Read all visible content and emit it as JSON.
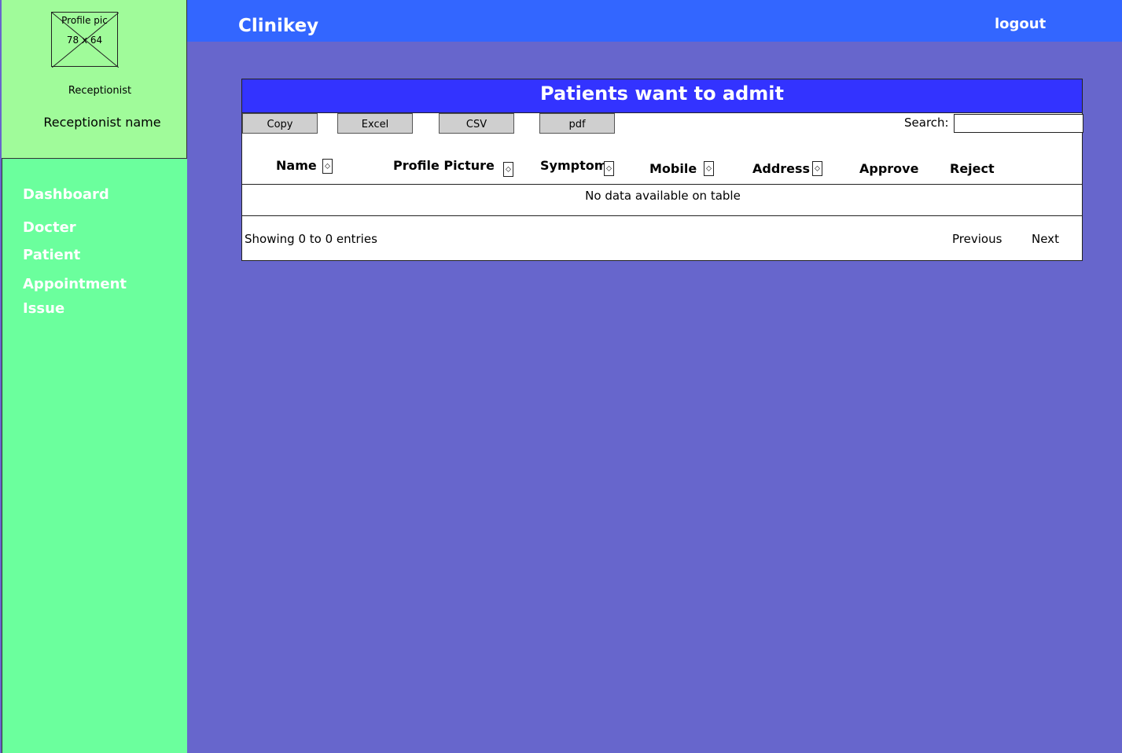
{
  "app": {
    "brand": "Clinikey",
    "logout_label": "logout"
  },
  "profile": {
    "placeholder_label": "Profile pic",
    "placeholder_size": "78 x 64",
    "role": "Receptionist",
    "name": "Receptionist name"
  },
  "sidebar": {
    "items": [
      {
        "label": "Dashboard"
      },
      {
        "label": "Docter"
      },
      {
        "label": "Patient"
      },
      {
        "label": "Appointment"
      },
      {
        "label": "Issue"
      }
    ]
  },
  "panel": {
    "title": "Patients want to admit",
    "toolbar": {
      "copy": "Copy",
      "excel": "Excel",
      "csv": "CSV",
      "pdf": "pdf"
    },
    "search_label": "Search:",
    "search_value": "",
    "columns": [
      {
        "label": "Name",
        "sortable": true
      },
      {
        "label": "Profile Picture",
        "sortable": true
      },
      {
        "label": "Symptom",
        "sortable": true
      },
      {
        "label": "Mobile",
        "sortable": true
      },
      {
        "label": "Address",
        "sortable": true
      },
      {
        "label": "Approve",
        "sortable": false
      },
      {
        "label": "Reject",
        "sortable": false
      }
    ],
    "sort_icon": "⬦",
    "empty_message": "No data available on table",
    "showing": "Showing 0 to 0 entries",
    "previous_label": "Previous",
    "next_label": "Next"
  },
  "colors": {
    "background": "#6766cc",
    "topbar": "#3366ff",
    "sidebar_top": "#a0fb9a",
    "sidebar_nav": "#6bff9d",
    "panel_header": "#3333ff"
  }
}
